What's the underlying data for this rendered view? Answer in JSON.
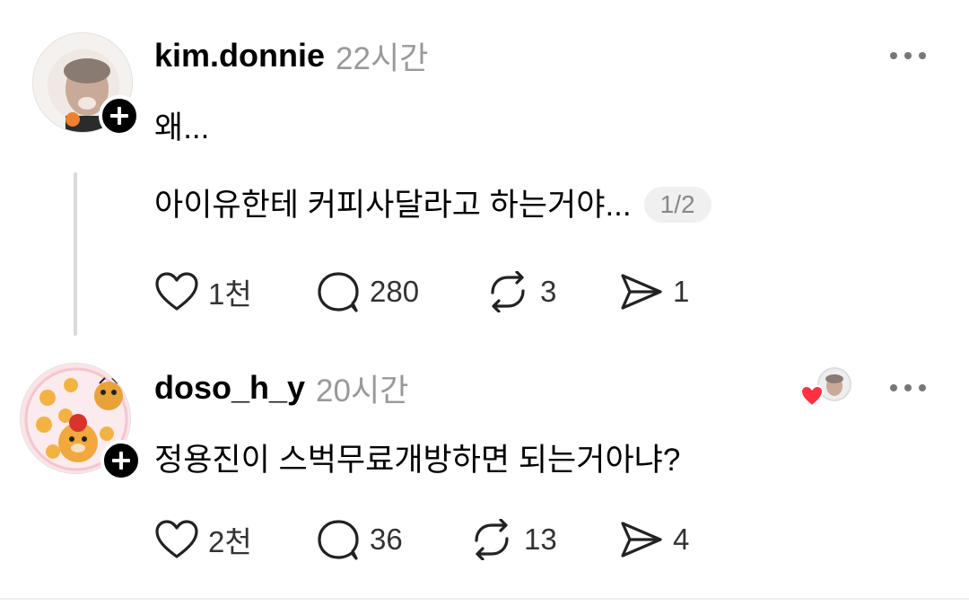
{
  "posts": [
    {
      "username": "kim.donnie",
      "time": "22시간",
      "text": "왜...",
      "quote_text": "아이유한테 커피사달라고 하는거야...",
      "page_indicator": "1/2",
      "likes": "1천",
      "comments": "280",
      "reposts": "3",
      "shares": "1"
    },
    {
      "username": "doso_h_y",
      "time": "20시간",
      "text": "정용진이 스벅무료개방하면 되는거아냐?",
      "likes": "2천",
      "comments": "36",
      "reposts": "13",
      "shares": "4"
    }
  ],
  "icons": {
    "like": "heart-outline-icon",
    "comment": "speech-bubble-icon",
    "repost": "repost-arrows-icon",
    "share": "send-icon",
    "more": "more-dots-icon",
    "follow": "plus-icon",
    "liked_by_author": "heart-filled-icon"
  },
  "colors": {
    "text": "#000000",
    "muted": "#999999",
    "heart_red": "#ff3040"
  }
}
